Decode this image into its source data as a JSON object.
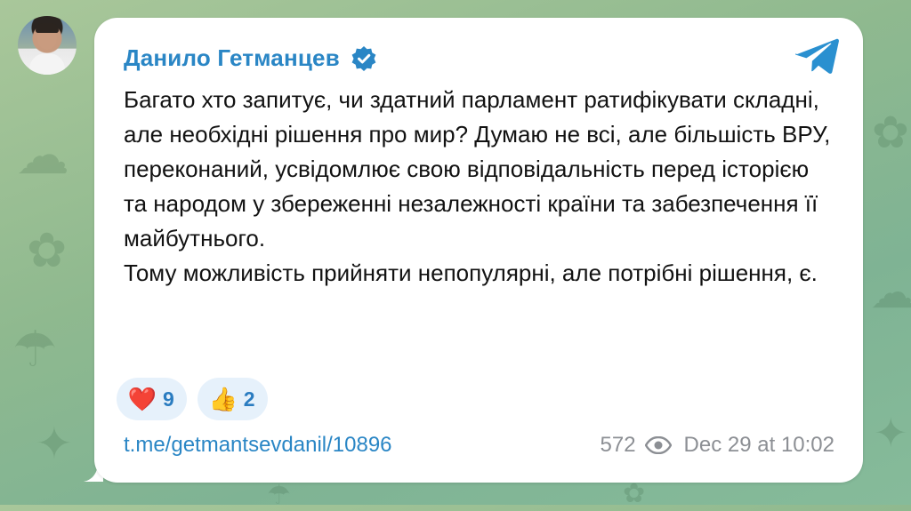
{
  "post": {
    "author": "Данило Гетманцев",
    "paragraphs": [
      "Багато хто запитує, чи здатний парламент ратифікувати складні, але необхідні рішення про мир? Думаю не всі, але більшість ВРУ, переконаний, усвідомлює свою відповідальність перед історією та народом у збереженні незалежності країни та забезпечення її майбутнього.",
      "Тому можливість прийняти непопулярні, але потрібні рішення, є."
    ],
    "reactions": [
      {
        "emoji": "❤️",
        "count": "9"
      },
      {
        "emoji": "👍",
        "count": "2"
      }
    ],
    "link": "t.me/getmantsevdanil/10896",
    "views": "572",
    "timestamp": "Dec 29 at 10:02"
  },
  "icons": {
    "verified": "verified-badge-icon",
    "telegram": "telegram-logo-icon",
    "views": "eye-icon"
  },
  "colors": {
    "accent": "#2a86c5",
    "reaction_bg": "#e6f1fb",
    "meta_text": "#8c8f94"
  }
}
